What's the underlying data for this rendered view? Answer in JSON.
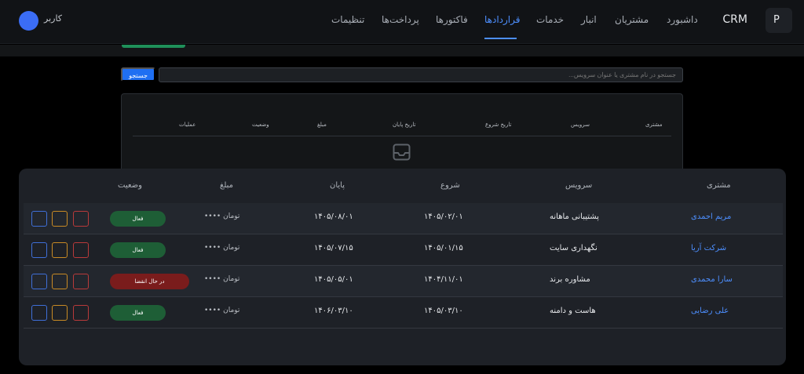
{
  "navbar": {
    "logo_letter": "P",
    "brand": "CRM",
    "items": [
      {
        "label": "داشبورد"
      },
      {
        "label": "مشتریان"
      },
      {
        "label": "انبار"
      },
      {
        "label": "خدمات"
      },
      {
        "label": "قراردادها",
        "active": true
      },
      {
        "label": "فاکتورها"
      },
      {
        "label": "پرداخت‌ها"
      },
      {
        "label": "تنظیمات"
      }
    ],
    "user_label": "کاربر",
    "accent_color": "#4d8fff"
  },
  "search": {
    "placeholder": "جستجو در نام مشتری یا عنوان سرویس...",
    "button_label": "جستجو"
  },
  "background_table": {
    "headers": [
      "مشتری",
      "سرویس",
      "تاریخ شروع",
      "تاریخ پایان",
      "مبلغ",
      "وضعیت",
      "عملیات"
    ],
    "empty_icon": "inbox-icon"
  },
  "contracts_table": {
    "headers": [
      "مشتری",
      "سرویس",
      "شروع",
      "پایان",
      "مبلغ",
      "وضعیت"
    ],
    "rows": [
      {
        "customer": "مریم احمدی",
        "service": "پشتیبانی ماهانه",
        "start": "۱۴۰۵/۰۲/۰۱",
        "end": "۱۴۰۵/۰۸/۰۱",
        "amount": "•••• تومان",
        "status": "فعال",
        "status_color": "#1e5e36"
      },
      {
        "customer": "شرکت آریا",
        "service": "نگهداری سایت",
        "start": "۱۴۰۵/۰۱/۱۵",
        "end": "۱۴۰۵/۰۷/۱۵",
        "amount": "•••• تومان",
        "status": "فعال",
        "status_color": "#1e5e36"
      },
      {
        "customer": "سارا محمدی",
        "service": "مشاوره برند",
        "start": "۱۴۰۴/۱۱/۰۱",
        "end": "۱۴۰۵/۰۵/۰۱",
        "amount": "•••• تومان",
        "status": "در حال انقضا",
        "status_color": "#7a1c1c"
      },
      {
        "customer": "علی رضایی",
        "service": "هاست و دامنه",
        "start": "۱۴۰۵/۰۳/۱۰",
        "end": "۱۴۰۶/۰۳/۱۰",
        "amount": "•••• تومان",
        "status": "فعال",
        "status_color": "#1e5e36"
      }
    ],
    "action_icons": [
      "delete-icon",
      "edit-icon",
      "view-icon"
    ]
  }
}
